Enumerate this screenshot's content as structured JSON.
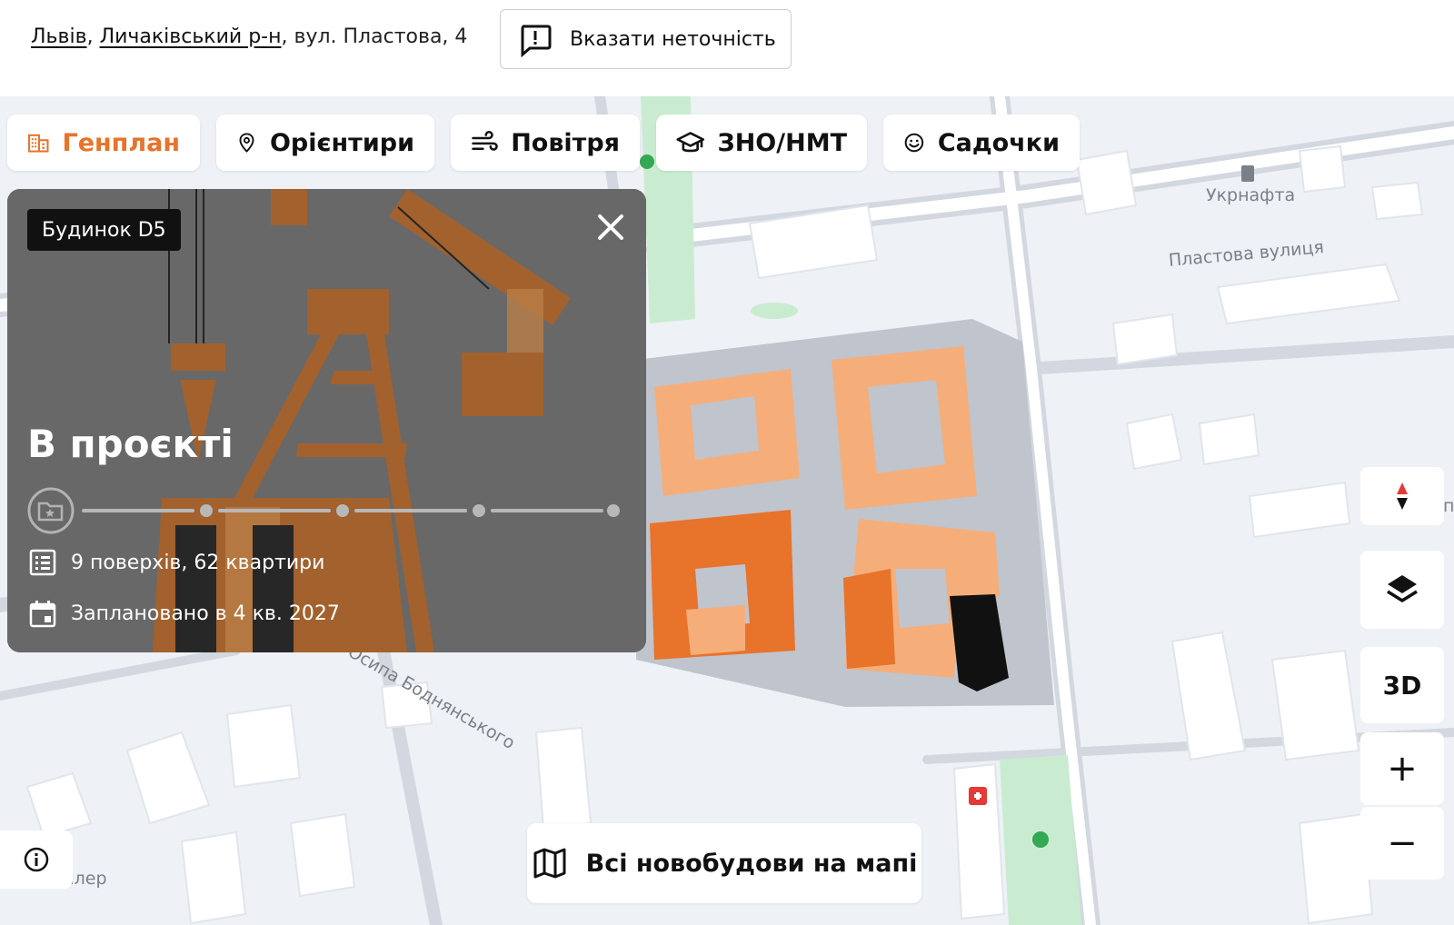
{
  "address": {
    "city": "Львів",
    "district": "Личаківський р-н",
    "street": "вул. Пластова, 4",
    "sep1": ",",
    "sep2": ","
  },
  "report_button": {
    "label": "Вказати неточність",
    "icon": "report-icon"
  },
  "tabs": [
    {
      "label": "Генплан",
      "icon": "buildings-icon",
      "active": true
    },
    {
      "label": "Орієнтири",
      "icon": "location-pin-icon",
      "active": false
    },
    {
      "label": "Повітря",
      "icon": "wind-icon",
      "active": false
    },
    {
      "label": "ЗНО/НМТ",
      "icon": "graduation-cap-icon",
      "active": false
    },
    {
      "label": "Садочки",
      "icon": "smiley-icon",
      "active": false
    }
  ],
  "card": {
    "badge": "Будинок D5",
    "status": "В проєкті",
    "progress_steps": 5,
    "progress_current": 0,
    "floors": "9 поверхів, 62 квартири",
    "planned": "Заплановано в 4 кв. 2027"
  },
  "map": {
    "labels": {
      "station": "Укрнафта",
      "street": "Пластова вулиця",
      "street2": "Осипа Боднянського",
      "poi": "алер",
      "edge": "п"
    },
    "accent": "#e8732a",
    "selected_building_color": "#111111"
  },
  "controls": {
    "compass_icon": "compass-icon",
    "layers_icon": "layers-icon",
    "mode_3d": "3D",
    "zoom_in": "+",
    "zoom_out": "−"
  },
  "all_buildings_button": {
    "label": "Всі новобудови на мапі",
    "icon": "map-icon"
  },
  "info_icon": "info-icon"
}
